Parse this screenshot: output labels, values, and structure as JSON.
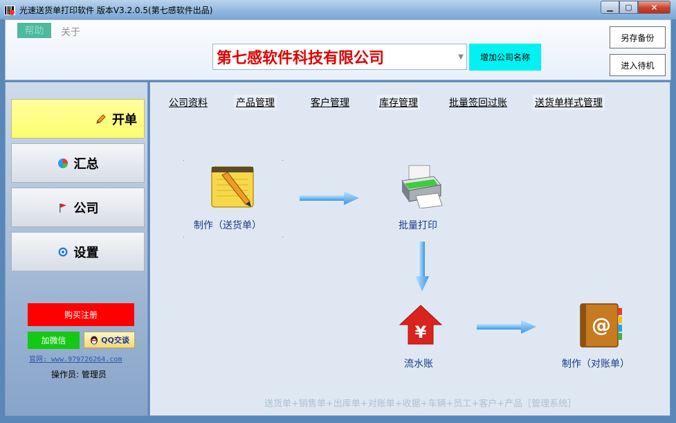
{
  "window": {
    "title": "光速送货单打印软件 版本V3.2.0.5(第七感软件出品)",
    "min_label": "▁",
    "max_label": "▢",
    "close_label": "✕"
  },
  "menu": {
    "help": "帮助",
    "about": "关于"
  },
  "company": {
    "selected": "第七感软件科技有限公司",
    "add_button": "增加公司名称"
  },
  "topright": {
    "backup": "另存备份",
    "standby": "进入待机"
  },
  "sidebar": {
    "items": [
      {
        "label": "开单",
        "icon": "pencil-icon"
      },
      {
        "label": "汇总",
        "icon": "pie-chart-icon"
      },
      {
        "label": "公司",
        "icon": "flag-icon"
      },
      {
        "label": "设置",
        "icon": "gear-icon"
      }
    ],
    "buy": "购买注册",
    "wechat": "加微信",
    "qq": "QQ交谈",
    "website": "官网: www.979726264.com",
    "operator": "操作员: 管理员"
  },
  "tabs": [
    "公司资料",
    "产品管理",
    "客户管理",
    "库存管理",
    "批量签回过账",
    "送货单样式管理"
  ],
  "flow": {
    "make_delivery": "制作（送货单）",
    "batch_print": "批量打印",
    "ledger": "流水账",
    "make_statement": "制作（对账单）"
  },
  "footer": "送货单+销售单+出库单+对账单+收据+车辆+员工+客户+产品［管理系统］",
  "colors": {
    "accent_yellow": "#ffff8a",
    "red": "#ff0000",
    "cyan": "#00f2f2",
    "green": "#14c814",
    "link_blue": "#1a3a8a"
  }
}
